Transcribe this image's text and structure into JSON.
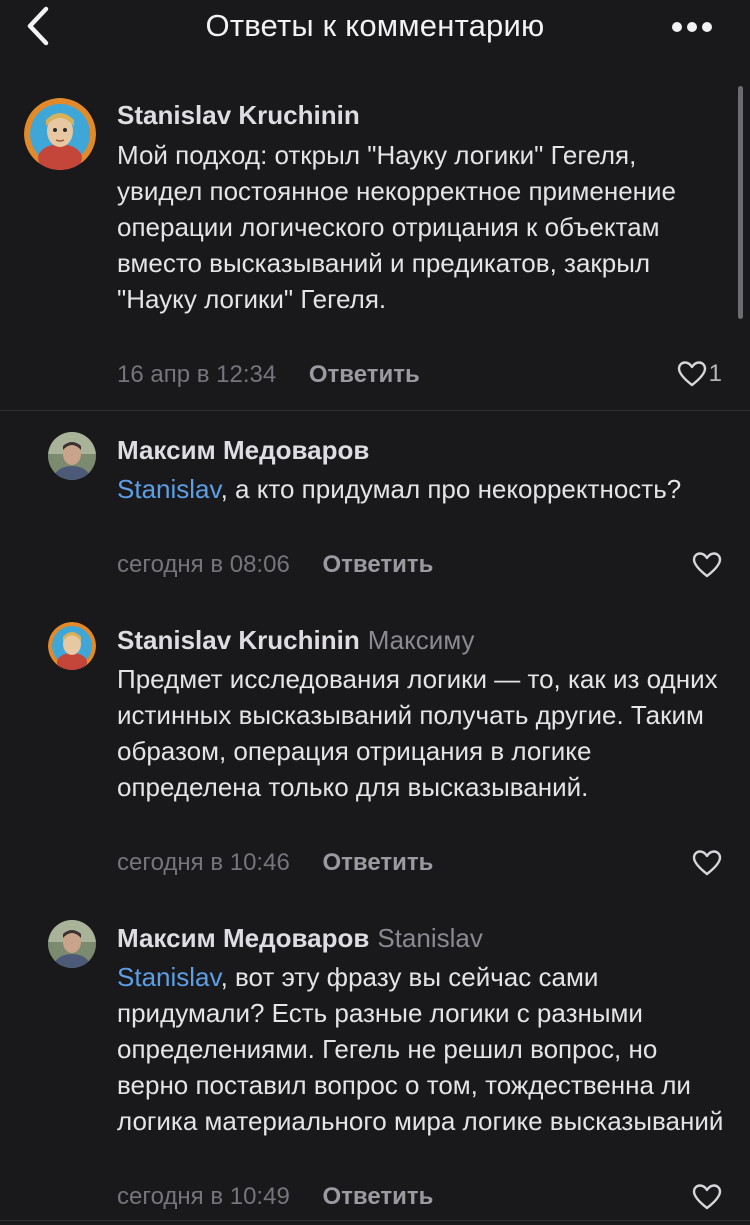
{
  "header": {
    "title": "Ответы к комментарию"
  },
  "comments": [
    {
      "author": "Stanislav Kruchinin",
      "text": "Мой подход: открыл \"Науку логики\" Гегеля, увидел постоянное некорректное применение операции логического отрицания к объектам вместо высказываний и предикатов, закрыл \"Науку логики\" Гегеля.",
      "time": "16 апр в 12:34",
      "reply_label": "Ответить",
      "likes": "1"
    },
    {
      "author": "Максим Медоваров",
      "mention": "Stanislav",
      "text": ", а кто придумал про некорректность?",
      "time": "сегодня в 08:06",
      "reply_label": "Ответить"
    },
    {
      "author": "Stanislav Kruchinin",
      "reply_to": "Максиму",
      "text": "Предмет исследования логики — то, как из одних истинных высказываний получать другие. Таким образом, операция отрицания в логике определена только для высказываний.",
      "time": "сегодня в 10:46",
      "reply_label": "Ответить"
    },
    {
      "author": "Максим Медоваров",
      "reply_to": "Stanislav",
      "mention": "Stanislav",
      "text": ", вот эту фразу вы сейчас сами придумали? Есть разные логики с разными определениями. Гегель не решил вопрос, но верно поставил вопрос о том, тождественна ли логика материального мира логике высказываний",
      "time": "сегодня в 10:49",
      "reply_label": "Ответить"
    }
  ],
  "colors": {
    "background": "#19191b",
    "mention": "#5c9fe6",
    "muted": "#75757b"
  },
  "icons": {
    "back": "chevron-left-icon",
    "more": "more-dots-icon",
    "like": "heart-outline-icon"
  }
}
